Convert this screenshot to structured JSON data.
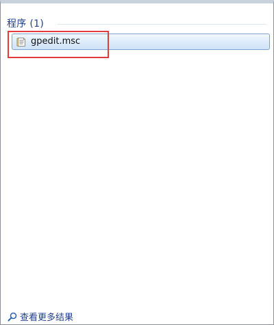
{
  "results": {
    "group_title": "程序 (1)",
    "items": [
      {
        "label": "gpedit.msc",
        "icon": "msc-file-icon"
      }
    ]
  },
  "footer": {
    "more_results_label": "查看更多结果",
    "icon": "search-icon"
  },
  "colors": {
    "group_title": "#1e3f8f",
    "selection_border": "#7da2ce",
    "annotation_border": "#e23b3b"
  }
}
